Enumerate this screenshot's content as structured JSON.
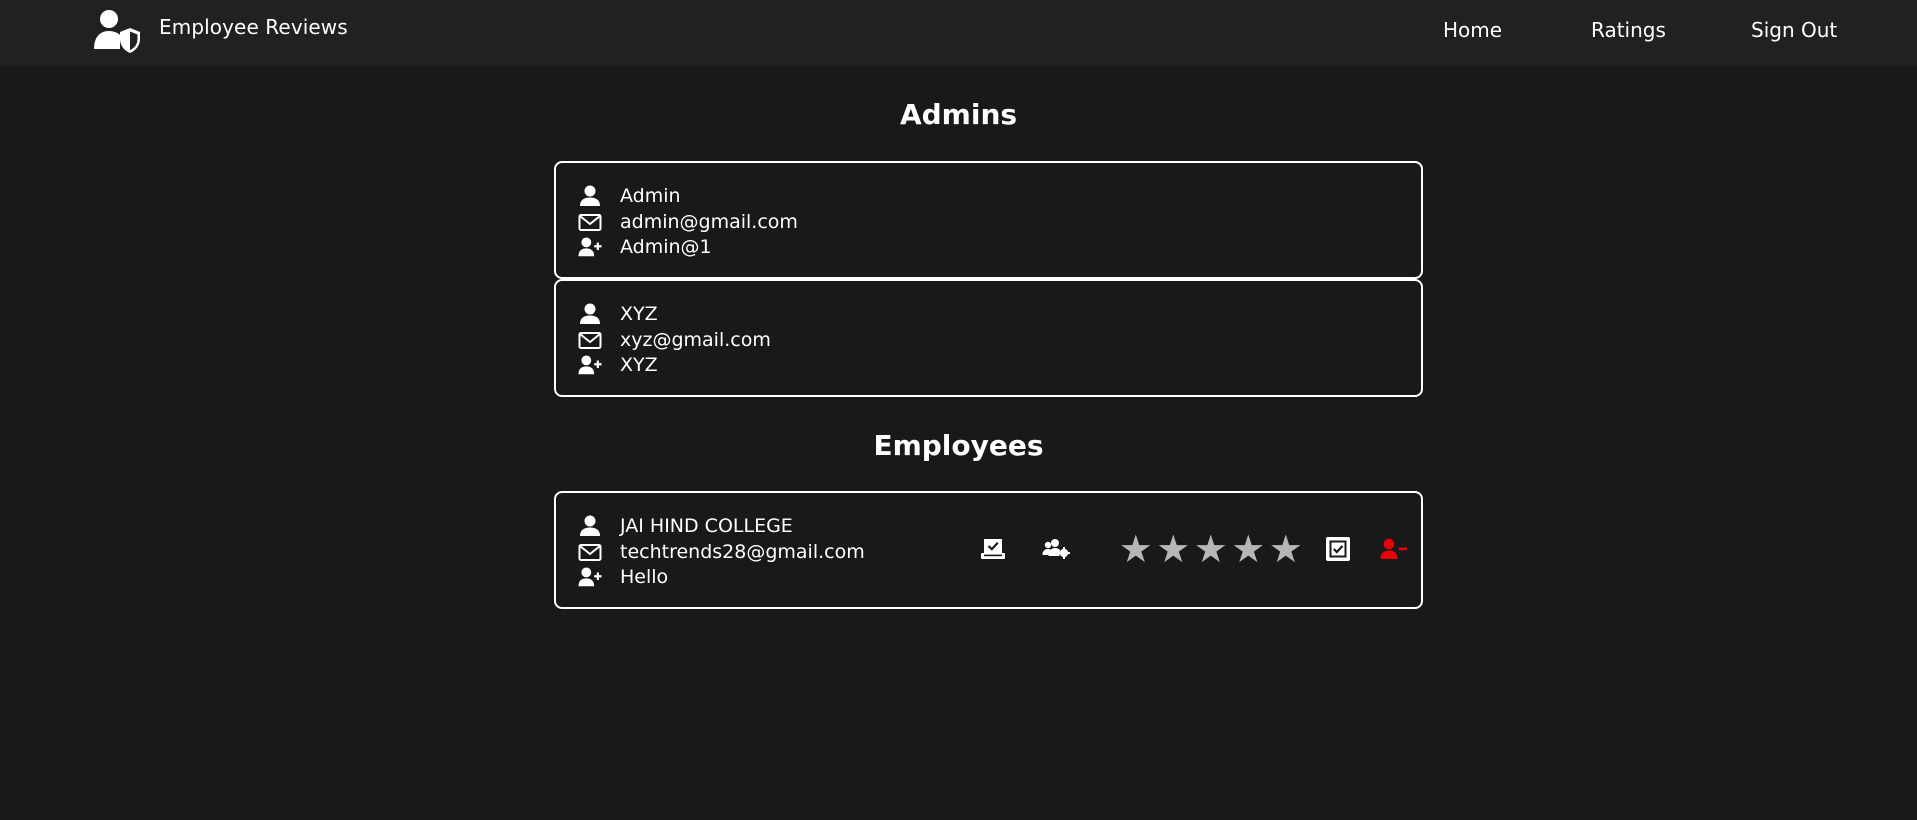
{
  "header": {
    "brand_title": "Employee Reviews",
    "logo_icon": "user-shield-icon",
    "nav": {
      "home": "Home",
      "ratings": "Ratings",
      "sign_out": "Sign Out"
    }
  },
  "admins_section": {
    "title": "Admins",
    "items": [
      {
        "name": "Admin",
        "email": "admin@gmail.com",
        "password": "Admin@1"
      },
      {
        "name": "XYZ",
        "email": "xyz@gmail.com",
        "password": "XYZ"
      }
    ]
  },
  "employees_section": {
    "title": "Employees",
    "items": [
      {
        "name": "JAI HIND COLLEGE",
        "email": "techtrends28@gmail.com",
        "password": "Hello",
        "rating": 0,
        "rating_max": 5,
        "actions": [
          "vote-icon",
          "users-cog-icon",
          "check-square-icon",
          "remove-user-icon"
        ]
      }
    ]
  },
  "colors": {
    "page_background": "#191919",
    "topbar_background": "#212121",
    "text": "#ffffff",
    "star_empty": "#b6b6b6",
    "danger": "#e8000b"
  },
  "icons": {
    "name": "user-icon",
    "email": "envelope-icon",
    "password": "user-plus-icon"
  }
}
